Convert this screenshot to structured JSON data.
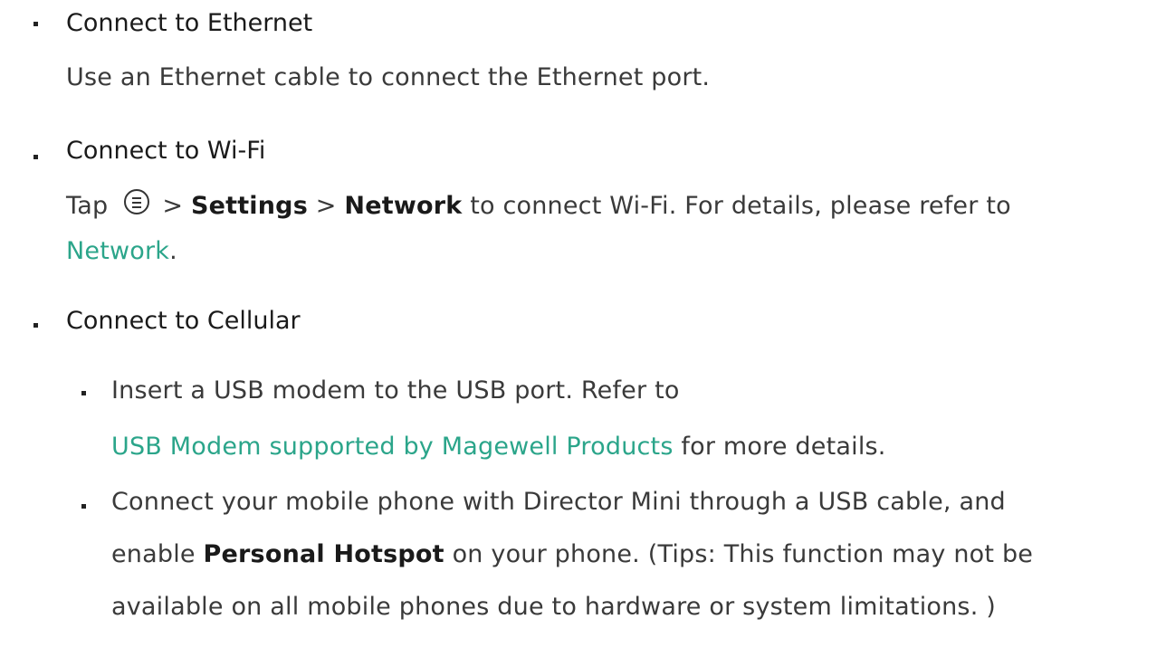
{
  "sections": [
    {
      "title": "Connect to Ethernet",
      "body": "Use an Ethernet cable to connect the Ethernet port."
    },
    {
      "title": "Connect to Wi-Fi",
      "tap": "Tap",
      "sep1": ">",
      "settings": "Settings",
      "sep2": ">",
      "network": "Network",
      "rest": "to connect Wi-Fi. For details, please refer to",
      "link": "Network",
      "period": "."
    },
    {
      "title": "Connect to Cellular",
      "sub1_line1": "Insert a USB modem to the USB port. Refer to",
      "sub1_link": "USB Modem supported by Magewell Products",
      "sub1_tail": "for more details.",
      "sub2_line1": "Connect your mobile phone with Director Mini through a USB cable, and",
      "sub2_pre": "enable",
      "sub2_bold": "Personal Hotspot",
      "sub2_post": "on your phone. (Tips: This function may not be",
      "sub2_line3": "available on all mobile phones due to hardware or system limitations. )"
    }
  ],
  "icons": {
    "menu": "menu-circle-icon"
  },
  "colors": {
    "link": "#2ba58a",
    "text": "#3a3a3a",
    "heading": "#1a1a1a"
  }
}
